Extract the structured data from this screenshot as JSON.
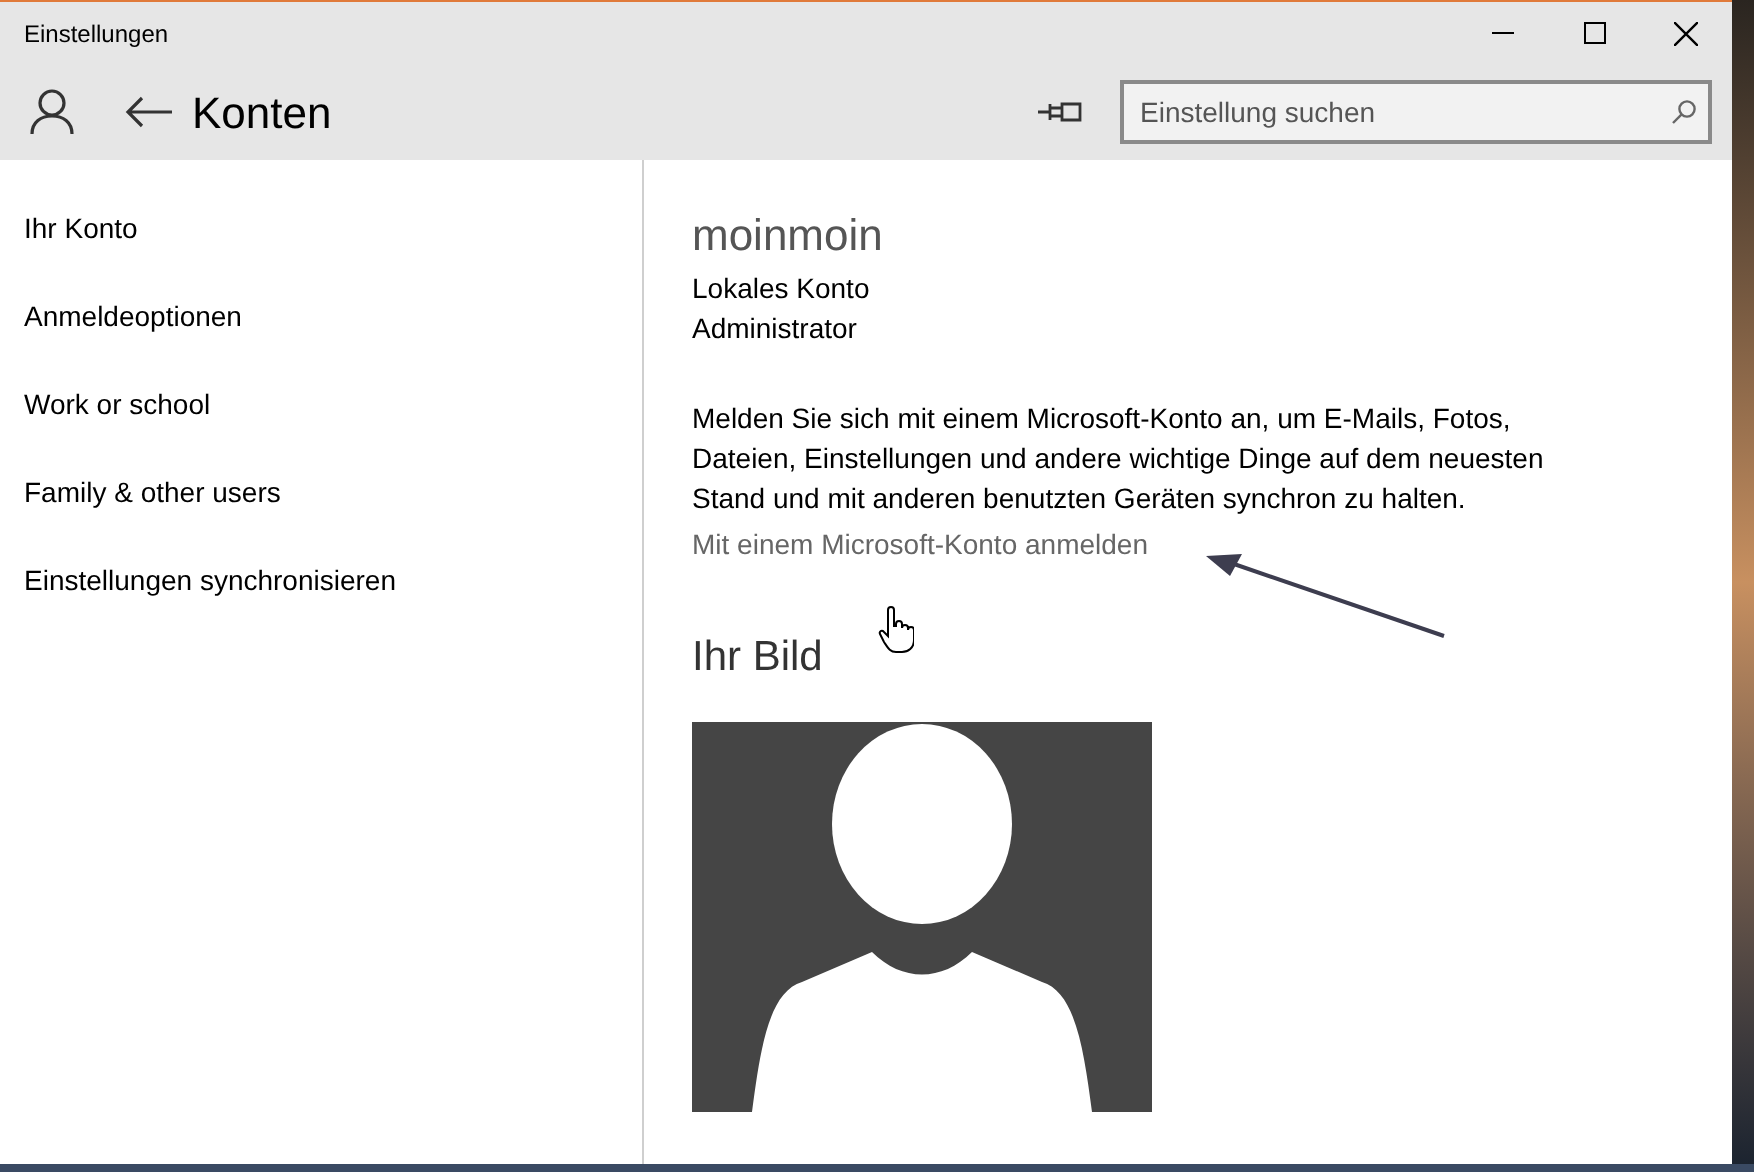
{
  "window": {
    "title": "Einstellungen"
  },
  "header": {
    "title": "Konten"
  },
  "search": {
    "placeholder": "Einstellung suchen"
  },
  "sidebar": {
    "items": [
      {
        "label": "Ihr Konto"
      },
      {
        "label": "Anmeldeoptionen"
      },
      {
        "label": "Work or school"
      },
      {
        "label": "Family & other users"
      },
      {
        "label": "Einstellungen synchronisieren"
      }
    ]
  },
  "account": {
    "name": "moinmoin",
    "type": "Lokales Konto",
    "role": "Administrator"
  },
  "description": "Melden Sie sich mit einem Microsoft-Konto an, um E-Mails, Fotos, Dateien, Einstellungen und andere wichtige Dinge auf dem neuesten Stand und mit anderen benutzten Geräten synchron zu halten.",
  "link": "Mit einem Microsoft-Konto anmelden",
  "picture_section": {
    "title": "Ihr Bild"
  }
}
